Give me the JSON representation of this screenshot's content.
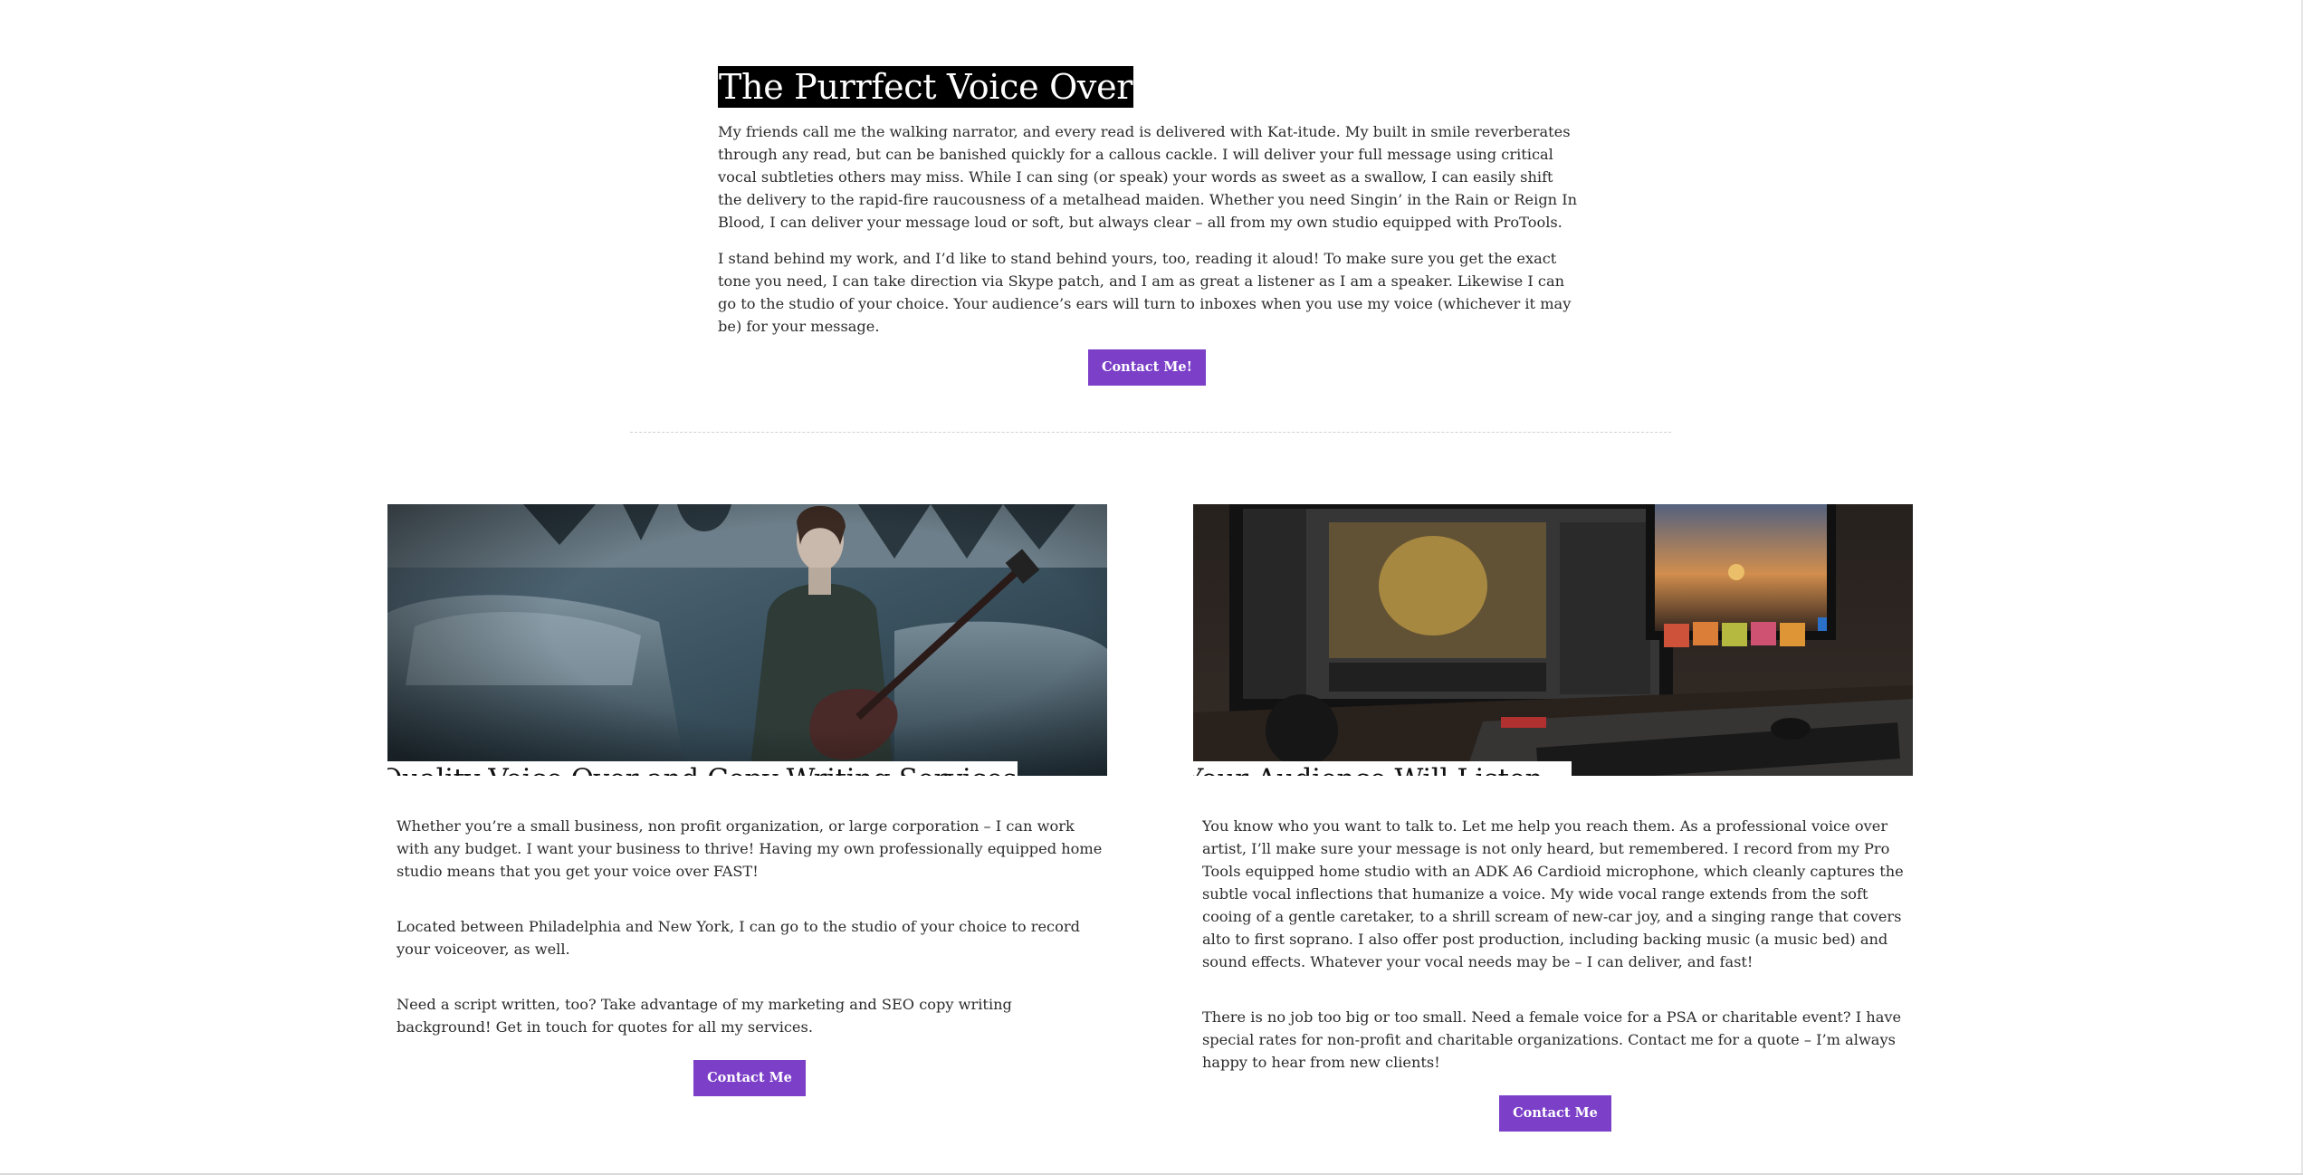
{
  "intro": {
    "title": "The Purrfect Voice Over",
    "paragraphs": [
      "My friends call me the walking narrator, and every read is delivered with Kat-itude. My built in smile reverberates through any read, but can be banished quickly for a callous cackle. I will deliver your full message using critical vocal subtleties others may miss. While I can sing (or speak) your words as sweet as a swallow, I can easily shift the delivery to the rapid-fire raucousness of a metalhead maiden. Whether you need Singin’ in the Rain or Reign In Blood, I can deliver your message loud or soft, but always clear – all from my own studio equipped with ProTools.",
      "I stand behind my work, and I’d like to stand behind yours, too, reading it aloud! To make sure you get the exact tone you need, I can take direction via Skype patch, and I am as great a  listener as I am a speaker. Likewise I can go to the studio of your choice. Your audience’s ears will turn to inboxes when you use my voice (whichever it may be) for your message."
    ],
    "button_label": "Contact Me!"
  },
  "left_column": {
    "title": "Quality Voice Over and Copy Writing Services",
    "paragraphs": [
      "Whether you’re a small business, non profit organization, or large corporation – I can work with any budget. I want your business to thrive! Having my own professionally equipped home studio means that you get your voice over FAST!",
      "Located between Philadelphia and New York, I can go to the studio of your choice to record your voiceover, as well.",
      "Need a script written, too? Take advantage of my marketing and SEO copy writing background!  Get in touch for quotes for all my services."
    ],
    "button_label": "Contact Me"
  },
  "right_column": {
    "title": "Your Audience Will Listen…",
    "paragraphs": [
      "You know who you want to talk to. Let me help you reach them. As a professional voice over artist, I’ll make sure your message is not only heard, but remembered. I record from my Pro Tools equipped home studio with an ADK A6 Cardioid microphone, which cleanly captures the subtle vocal inflections that humanize a voice. My wide vocal range extends from the soft cooing of a gentle caretaker, to a shrill scream of new-car joy, and a singing range that covers alto to first soprano. I also offer post production, including backing music (a music bed) and sound effects. Whatever your vocal needs may be – I can deliver, and fast!",
      "There is no job too big or too small. Need a female voice for a PSA or charitable event? I have special rates for non-profit and charitable organizations. Contact me for a quote – I’m always happy to hear from new clients!"
    ],
    "button_label": "Contact Me"
  },
  "colors": {
    "accent": "#7b3fc8",
    "title_highlight": "#000000",
    "text": "#2b2b2b"
  }
}
